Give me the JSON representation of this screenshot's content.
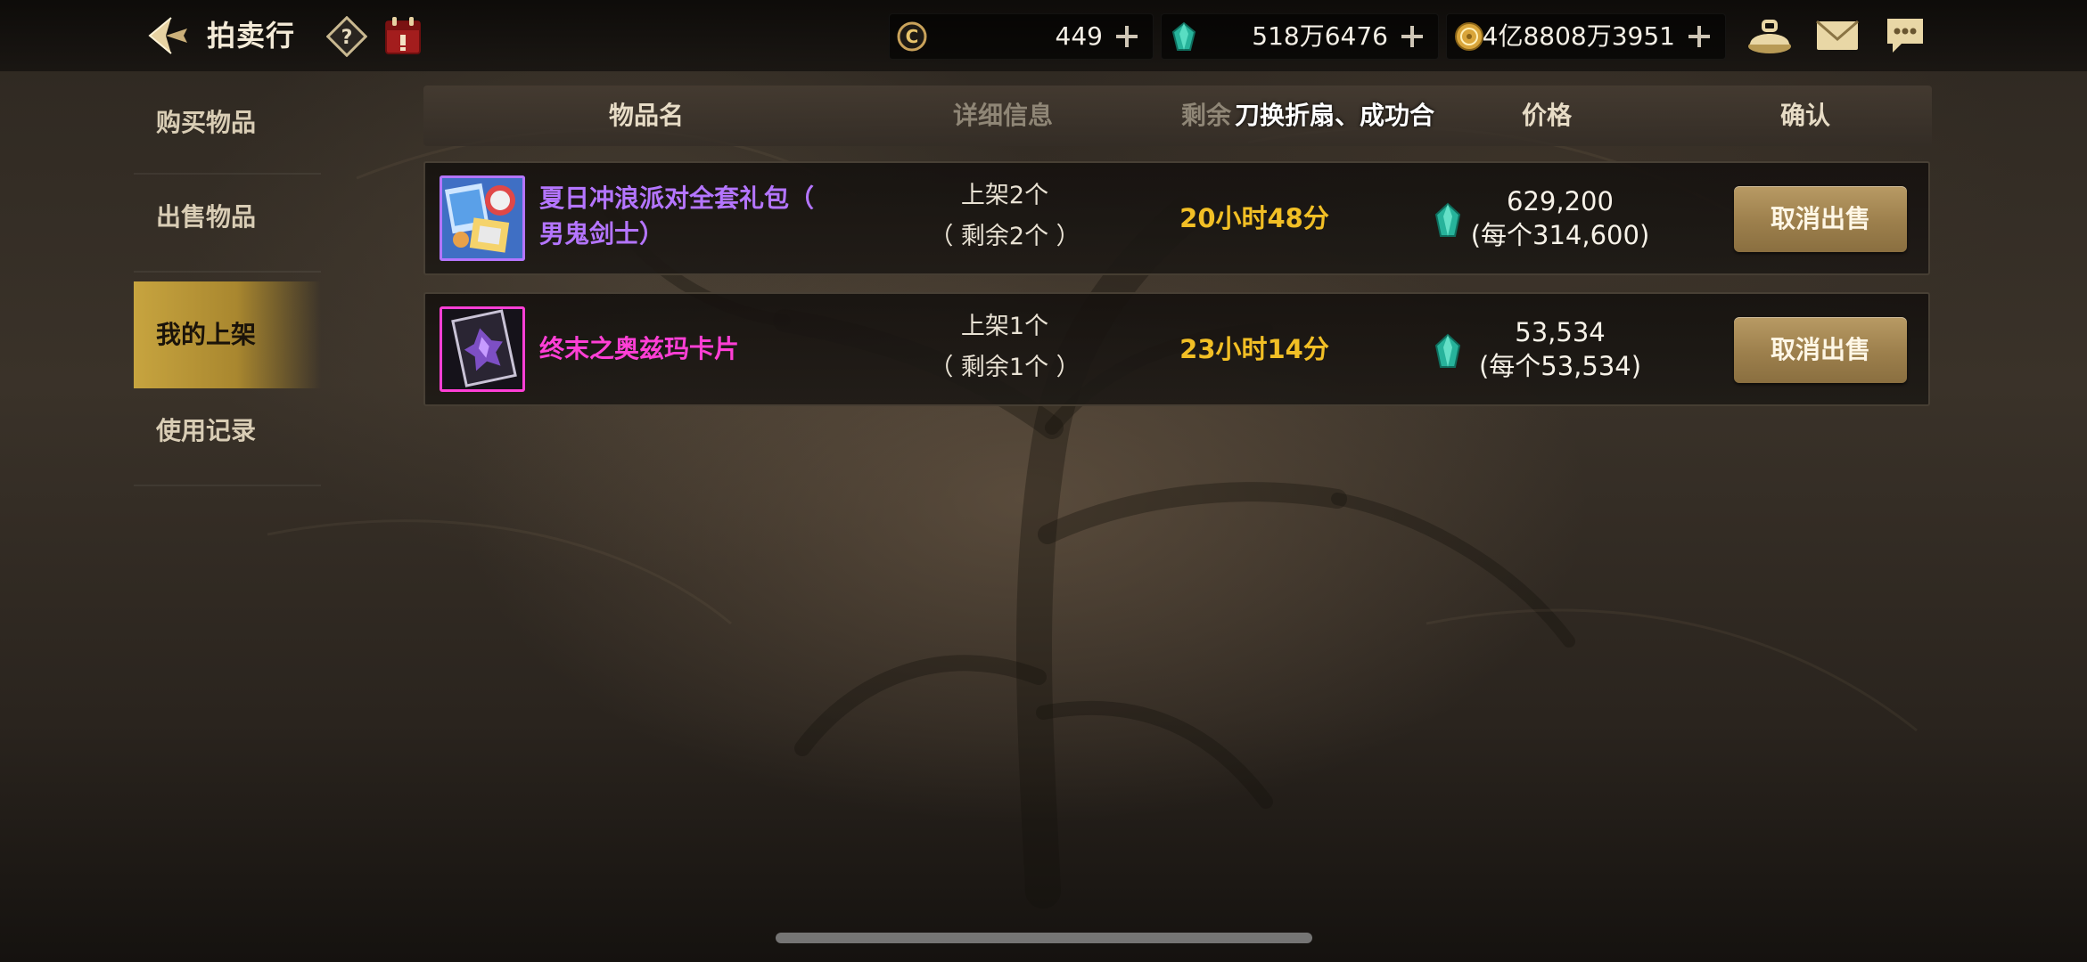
{
  "header": {
    "title": "拍卖行",
    "currencies": [
      {
        "icon": "c-coin-icon",
        "value": "449"
      },
      {
        "icon": "gem-icon",
        "value": "518万6476"
      },
      {
        "icon": "gold-coin-icon",
        "value": "4亿8808万3951"
      }
    ]
  },
  "sidebar": {
    "items": [
      {
        "label": "购买物品",
        "active": false
      },
      {
        "label": "出售物品",
        "active": false
      },
      {
        "label": "我的上架",
        "active": true
      },
      {
        "label": "使用记录",
        "active": false
      }
    ]
  },
  "table": {
    "columns": {
      "name": "物品名",
      "detail": "详细信息",
      "remaining": "剩余",
      "overlay_text": "刀换折扇、成功合",
      "price": "价格",
      "confirm": "确认"
    },
    "rows": [
      {
        "name_line1": "夏日冲浪派对全套礼包（",
        "name_line2": "男鬼剑士）",
        "detail_line1": "上架2个",
        "detail_line2": "（ 剩余2个 ）",
        "time_left": "20小时48分",
        "price_total": "629,200",
        "price_each": "(每个314,600)",
        "button": "取消出售"
      },
      {
        "name_line1": "终末之奥兹玛卡片",
        "detail_line1": "上架1个",
        "detail_line2": "（ 剩余1个 ）",
        "time_left": "23小时14分",
        "price_total": "53,534",
        "price_each": "(每个53,534)",
        "button": "取消出售"
      }
    ]
  },
  "colors": {
    "rare_purple": "#b475ff",
    "legendary_pink": "#ff3fd6",
    "time_gold": "#f2bf25",
    "button_gold": "#a88a55",
    "active_tab_gold": "#c7a43f"
  }
}
